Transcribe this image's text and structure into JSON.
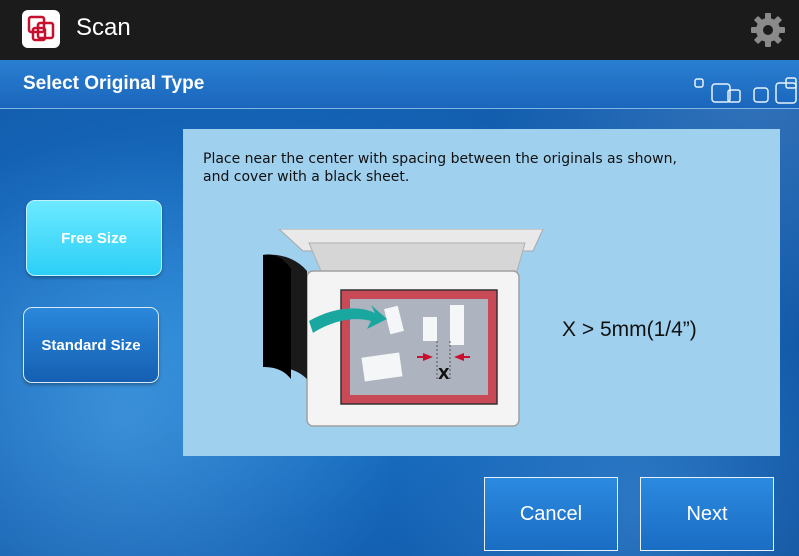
{
  "header": {
    "app_title": "Scan",
    "app_icon": "scan-icon",
    "settings_icon": "gear-icon"
  },
  "subheader": {
    "title": "Select Original Type"
  },
  "original_type": {
    "options": [
      {
        "label": "Free Size",
        "selected": true
      },
      {
        "label": "Standard Size",
        "selected": false
      }
    ]
  },
  "panel": {
    "instruction_line1": "Place near the center with spacing between the originals as shown,",
    "instruction_line2": "and cover with a black sheet.",
    "diagram_label": "X",
    "formula": "X > 5mm(1/4”)"
  },
  "actions": {
    "cancel_label": "Cancel",
    "next_label": "Next"
  },
  "colors": {
    "selected": "#2ccff7",
    "button": "#1a6dc3",
    "accent_red": "#c8102e",
    "arrow_teal": "#1aa7a0"
  }
}
